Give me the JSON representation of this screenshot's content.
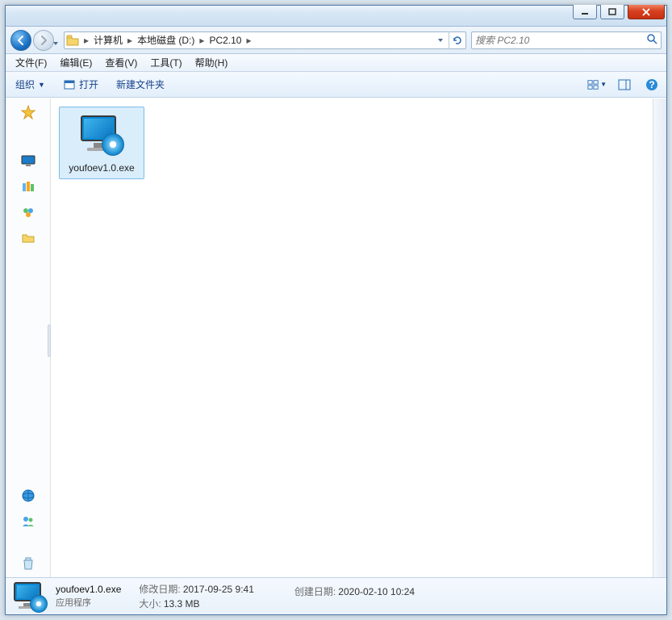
{
  "breadcrumbs": [
    "计算机",
    "本地磁盘 (D:)",
    "PC2.10"
  ],
  "search": {
    "placeholder": "搜索 PC2.10"
  },
  "menu": {
    "file": "文件(F)",
    "edit": "编辑(E)",
    "view": "查看(V)",
    "tools": "工具(T)",
    "help": "帮助(H)"
  },
  "cmdbar": {
    "organize": "组织",
    "open": "打开",
    "newfolder": "新建文件夹"
  },
  "file": {
    "name": "youfoev1.0.exe"
  },
  "details": {
    "name": "youfoev1.0.exe",
    "type": "应用程序",
    "modified_label": "修改日期:",
    "modified_value": "2017-09-25 9:41",
    "size_label": "大小:",
    "size_value": "13.3 MB",
    "created_label": "创建日期:",
    "created_value": "2020-02-10 10:24"
  }
}
